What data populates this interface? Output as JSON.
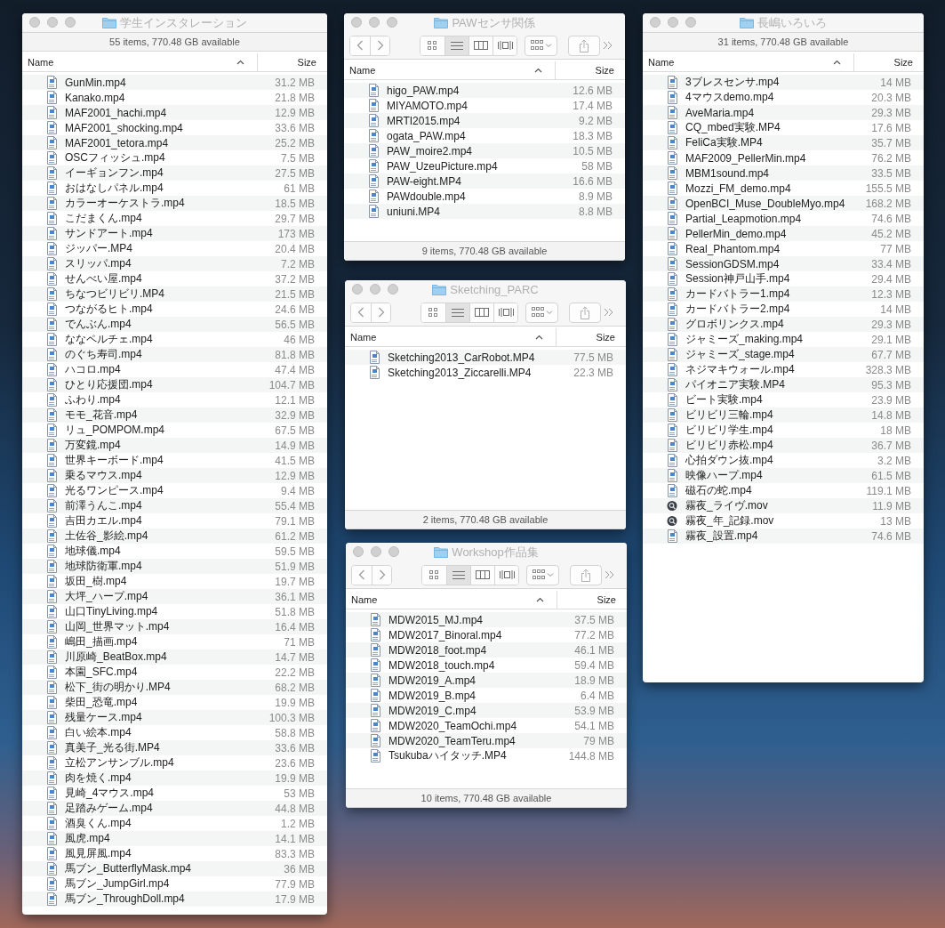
{
  "windows": [
    {
      "title": "学生インスタレーション",
      "status": "55 items, 770.48 GB available",
      "columns": [
        "Name",
        "Size"
      ],
      "files": [
        {
          "name": "GunMin.mp4",
          "size": "31.2 MB",
          "kind": "video"
        },
        {
          "name": "Kanako.mp4",
          "size": "21.8 MB",
          "kind": "video"
        },
        {
          "name": "MAF2001_hachi.mp4",
          "size": "12.9 MB",
          "kind": "video"
        },
        {
          "name": "MAF2001_shocking.mp4",
          "size": "33.6 MB",
          "kind": "video"
        },
        {
          "name": "MAF2001_tetora.mp4",
          "size": "25.2 MB",
          "kind": "video"
        },
        {
          "name": "OSCフィッシュ.mp4",
          "size": "7.5 MB",
          "kind": "video"
        },
        {
          "name": "イーギョンフン.mp4",
          "size": "27.5 MB",
          "kind": "video"
        },
        {
          "name": "おはなしパネル.mp4",
          "size": "61 MB",
          "kind": "video"
        },
        {
          "name": "カラーオーケストラ.mp4",
          "size": "18.5 MB",
          "kind": "video"
        },
        {
          "name": "こだまくん.mp4",
          "size": "29.7 MB",
          "kind": "video"
        },
        {
          "name": "サンドアート.mp4",
          "size": "173 MB",
          "kind": "video"
        },
        {
          "name": "ジッパー.MP4",
          "size": "20.4 MB",
          "kind": "video"
        },
        {
          "name": "スリッパ.mp4",
          "size": "7.2 MB",
          "kind": "video"
        },
        {
          "name": "せんべい屋.mp4",
          "size": "37.2 MB",
          "kind": "video"
        },
        {
          "name": "ちなつビリビリ.MP4",
          "size": "21.5 MB",
          "kind": "video"
        },
        {
          "name": "つながるヒト.mp4",
          "size": "24.6 MB",
          "kind": "video"
        },
        {
          "name": "でんぶん.mp4",
          "size": "56.5 MB",
          "kind": "video"
        },
        {
          "name": "ななペルチェ.mp4",
          "size": "46 MB",
          "kind": "video"
        },
        {
          "name": "のぐち寿司.mp4",
          "size": "81.8 MB",
          "kind": "video"
        },
        {
          "name": "ハコロ.mp4",
          "size": "47.4 MB",
          "kind": "video"
        },
        {
          "name": "ひとり応援団.mp4",
          "size": "104.7 MB",
          "kind": "video"
        },
        {
          "name": "ふわり.mp4",
          "size": "12.1 MB",
          "kind": "video"
        },
        {
          "name": "モモ_花音.mp4",
          "size": "32.9 MB",
          "kind": "video"
        },
        {
          "name": "リュ_POMPOM.mp4",
          "size": "67.5 MB",
          "kind": "video"
        },
        {
          "name": "万変鏡.mp4",
          "size": "14.9 MB",
          "kind": "video"
        },
        {
          "name": "世界キーボード.mp4",
          "size": "41.5 MB",
          "kind": "video"
        },
        {
          "name": "乗るマウス.mp4",
          "size": "12.9 MB",
          "kind": "video"
        },
        {
          "name": "光るワンピース.mp4",
          "size": "9.4 MB",
          "kind": "video"
        },
        {
          "name": "前澤うんこ.mp4",
          "size": "55.4 MB",
          "kind": "video"
        },
        {
          "name": "吉田カエル.mp4",
          "size": "79.1 MB",
          "kind": "video"
        },
        {
          "name": "土佐谷_影絵.mp4",
          "size": "61.2 MB",
          "kind": "video"
        },
        {
          "name": "地球儀.mp4",
          "size": "59.5 MB",
          "kind": "video"
        },
        {
          "name": "地球防衛軍.mp4",
          "size": "51.9 MB",
          "kind": "video"
        },
        {
          "name": "坂田_樹.mp4",
          "size": "19.7 MB",
          "kind": "video"
        },
        {
          "name": "大坪_ハープ.mp4",
          "size": "36.1 MB",
          "kind": "video"
        },
        {
          "name": "山口TinyLiving.mp4",
          "size": "51.8 MB",
          "kind": "video"
        },
        {
          "name": "山岡_世界マット.mp4",
          "size": "16.4 MB",
          "kind": "video"
        },
        {
          "name": "嶋田_描画.mp4",
          "size": "71 MB",
          "kind": "video"
        },
        {
          "name": "川原崎_BeatBox.mp4",
          "size": "14.7 MB",
          "kind": "video"
        },
        {
          "name": "本園_SFC.mp4",
          "size": "22.2 MB",
          "kind": "video"
        },
        {
          "name": "松下_街の明かり.MP4",
          "size": "68.2 MB",
          "kind": "video"
        },
        {
          "name": "柴田_恐竜.mp4",
          "size": "19.9 MB",
          "kind": "video"
        },
        {
          "name": "残量ケース.mp4",
          "size": "100.3 MB",
          "kind": "video"
        },
        {
          "name": "白い絵本.mp4",
          "size": "58.8 MB",
          "kind": "video"
        },
        {
          "name": "真美子_光る街.MP4",
          "size": "33.6 MB",
          "kind": "video"
        },
        {
          "name": "立松アンサンブル.mp4",
          "size": "23.6 MB",
          "kind": "video"
        },
        {
          "name": "肉を焼く.mp4",
          "size": "19.9 MB",
          "kind": "video"
        },
        {
          "name": "見崎_4マウス.mp4",
          "size": "53 MB",
          "kind": "video"
        },
        {
          "name": "足踏みゲーム.mp4",
          "size": "44.8 MB",
          "kind": "video"
        },
        {
          "name": "酒臭くん.mp4",
          "size": "1.2 MB",
          "kind": "video"
        },
        {
          "name": "風虎.mp4",
          "size": "14.1 MB",
          "kind": "video"
        },
        {
          "name": "風見屏風.mp4",
          "size": "83.3 MB",
          "kind": "video"
        },
        {
          "name": "馬ブン_ButterflyMask.mp4",
          "size": "36 MB",
          "kind": "video"
        },
        {
          "name": "馬ブン_JumpGirl.mp4",
          "size": "77.9 MB",
          "kind": "video"
        },
        {
          "name": "馬ブン_ThroughDoll.mp4",
          "size": "17.9 MB",
          "kind": "video"
        }
      ]
    },
    {
      "title": "PAWセンサ関係",
      "status": "9 items, 770.48 GB available",
      "columns": [
        "Name",
        "Size"
      ],
      "toolbar": {
        "view_modes": [
          {
            "kind": "icons",
            "selected": false
          },
          {
            "kind": "list",
            "selected": true
          },
          {
            "kind": "columns",
            "selected": false
          },
          {
            "kind": "cover_flow",
            "selected": false
          }
        ]
      },
      "files": [
        {
          "name": "higo_PAW.mp4",
          "size": "12.6 MB",
          "kind": "video"
        },
        {
          "name": "MIYAMOTO.mp4",
          "size": "17.4 MB",
          "kind": "video"
        },
        {
          "name": "MRTI2015.mp4",
          "size": "9.2 MB",
          "kind": "video"
        },
        {
          "name": "ogata_PAW.mp4",
          "size": "18.3 MB",
          "kind": "video"
        },
        {
          "name": "PAW_moire2.mp4",
          "size": "10.5 MB",
          "kind": "video"
        },
        {
          "name": "PAW_UzeuPicture.mp4",
          "size": "58 MB",
          "kind": "video"
        },
        {
          "name": "PAW-eight.MP4",
          "size": "16.6 MB",
          "kind": "video"
        },
        {
          "name": "PAWdouble.mp4",
          "size": "8.9 MB",
          "kind": "video"
        },
        {
          "name": "uniuni.MP4",
          "size": "8.8 MB",
          "kind": "video"
        }
      ]
    },
    {
      "title": "Sketching_PARC",
      "status": "2 items, 770.48 GB available",
      "columns": [
        "Name",
        "Size"
      ],
      "toolbar": {
        "view_modes": [
          {
            "kind": "icons",
            "selected": false
          },
          {
            "kind": "list",
            "selected": true
          },
          {
            "kind": "columns",
            "selected": false
          },
          {
            "kind": "cover_flow",
            "selected": false
          }
        ]
      },
      "files": [
        {
          "name": "Sketching2013_CarRobot.MP4",
          "size": "77.5 MB",
          "kind": "video"
        },
        {
          "name": "Sketching2013_Ziccarelli.MP4",
          "size": "22.3 MB",
          "kind": "video"
        }
      ]
    },
    {
      "title": "Workshop作品集",
      "status": "10 items, 770.48 GB available",
      "columns": [
        "Name",
        "Size"
      ],
      "toolbar": {
        "view_modes": [
          {
            "kind": "icons",
            "selected": false
          },
          {
            "kind": "list",
            "selected": true
          },
          {
            "kind": "columns",
            "selected": false
          },
          {
            "kind": "cover_flow",
            "selected": false
          }
        ]
      },
      "files": [
        {
          "name": "MDW2015_MJ.mp4",
          "size": "37.5 MB",
          "kind": "video"
        },
        {
          "name": "MDW2017_Binoral.mp4",
          "size": "77.2 MB",
          "kind": "video"
        },
        {
          "name": "MDW2018_foot.mp4",
          "size": "46.1 MB",
          "kind": "video"
        },
        {
          "name": "MDW2018_touch.mp4",
          "size": "59.4 MB",
          "kind": "video"
        },
        {
          "name": "MDW2019_A.mp4",
          "size": "18.9 MB",
          "kind": "video"
        },
        {
          "name": "MDW2019_B.mp4",
          "size": "6.4 MB",
          "kind": "video"
        },
        {
          "name": "MDW2019_C.mp4",
          "size": "53.9 MB",
          "kind": "video"
        },
        {
          "name": "MDW2020_TeamOchi.mp4",
          "size": "54.1 MB",
          "kind": "video"
        },
        {
          "name": "MDW2020_TeamTeru.mp4",
          "size": "79 MB",
          "kind": "video"
        },
        {
          "name": "Tsukubaハイタッチ.MP4",
          "size": "144.8 MB",
          "kind": "video"
        }
      ]
    },
    {
      "title": "長嶋いろいろ",
      "status": "31 items, 770.48 GB available",
      "columns": [
        "Name",
        "Size"
      ],
      "files": [
        {
          "name": "3ブレスセンサ.mp4",
          "size": "14 MB",
          "kind": "video"
        },
        {
          "name": "4マウスdemo.mp4",
          "size": "20.3 MB",
          "kind": "video"
        },
        {
          "name": "AveMaria.mp4",
          "size": "29.3 MB",
          "kind": "video"
        },
        {
          "name": "CQ_mbed実験.MP4",
          "size": "17.6 MB",
          "kind": "video"
        },
        {
          "name": "FeliCa実験.MP4",
          "size": "35.7 MB",
          "kind": "video"
        },
        {
          "name": "MAF2009_PellerMin.mp4",
          "size": "76.2 MB",
          "kind": "video"
        },
        {
          "name": "MBM1sound.mp4",
          "size": "33.5 MB",
          "kind": "video"
        },
        {
          "name": "Mozzi_FM_demo.mp4",
          "size": "155.5 MB",
          "kind": "video"
        },
        {
          "name": "OpenBCI_Muse_DoubleMyo.mp4",
          "size": "168.2 MB",
          "kind": "video"
        },
        {
          "name": "Partial_Leapmotion.mp4",
          "size": "74.6 MB",
          "kind": "video"
        },
        {
          "name": "PellerMin_demo.mp4",
          "size": "45.2 MB",
          "kind": "video"
        },
        {
          "name": "Real_Phantom.mp4",
          "size": "77 MB",
          "kind": "video"
        },
        {
          "name": "SessionGDSM.mp4",
          "size": "33.4 MB",
          "kind": "video"
        },
        {
          "name": "Session神戸山手.mp4",
          "size": "29.4 MB",
          "kind": "video"
        },
        {
          "name": "カードバトラー1.mp4",
          "size": "12.3 MB",
          "kind": "video"
        },
        {
          "name": "カードバトラー2.mp4",
          "size": "14 MB",
          "kind": "video"
        },
        {
          "name": "グロボリンクス.mp4",
          "size": "29.3 MB",
          "kind": "video"
        },
        {
          "name": "ジャミーズ_making.mp4",
          "size": "29.1 MB",
          "kind": "video"
        },
        {
          "name": "ジャミーズ_stage.mp4",
          "size": "67.7 MB",
          "kind": "video"
        },
        {
          "name": "ネジマキウォール.mp4",
          "size": "328.3 MB",
          "kind": "video"
        },
        {
          "name": "パイオニア実験.MP4",
          "size": "95.3 MB",
          "kind": "video"
        },
        {
          "name": "ビート実験.mp4",
          "size": "23.9 MB",
          "kind": "video"
        },
        {
          "name": "ビリビリ三輪.mp4",
          "size": "14.8 MB",
          "kind": "video"
        },
        {
          "name": "ビリビリ学生.mp4",
          "size": "18 MB",
          "kind": "video"
        },
        {
          "name": "ビリビリ赤松.mp4",
          "size": "36.7 MB",
          "kind": "video"
        },
        {
          "name": "心拍ダウン抜.mp4",
          "size": "3.2 MB",
          "kind": "video"
        },
        {
          "name": "映像ハープ.mp4",
          "size": "61.5 MB",
          "kind": "video"
        },
        {
          "name": "磁石の蛇.mp4",
          "size": "119.1 MB",
          "kind": "video"
        },
        {
          "name": "霧夜_ライヴ.mov",
          "size": "11.9 MB",
          "kind": "movie"
        },
        {
          "name": "霧夜_年_記録.mov",
          "size": "13 MB",
          "kind": "movie"
        },
        {
          "name": "霧夜_設置.mp4",
          "size": "74.6 MB",
          "kind": "video"
        }
      ]
    }
  ]
}
